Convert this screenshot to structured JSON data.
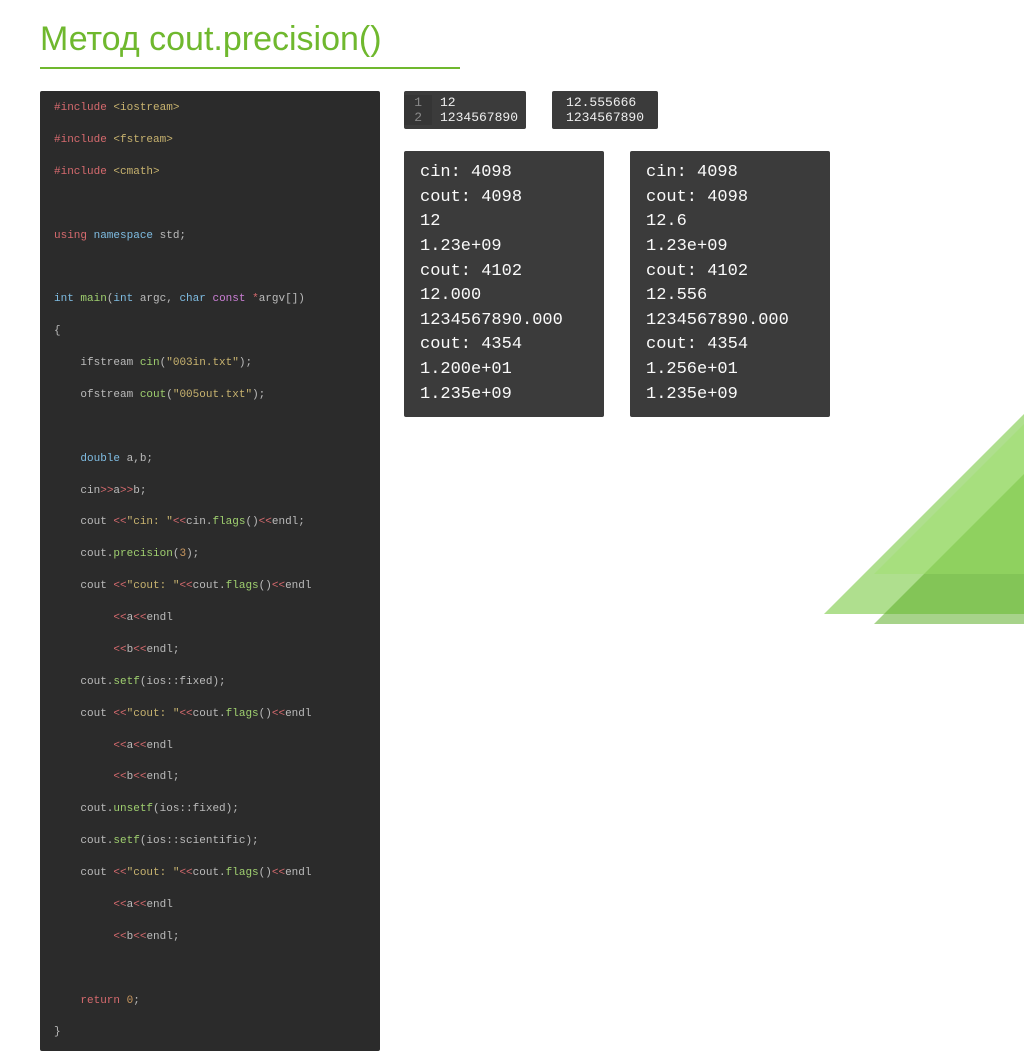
{
  "title": "Метод cout.precision()",
  "code": [
    {
      "cls": "kw-pre",
      "txt": "#include "
    },
    {
      "cls": "str",
      "txt": "<iostream>"
    },
    {
      "br": 1
    },
    {
      "cls": "kw-pre",
      "txt": "#include "
    },
    {
      "cls": "str",
      "txt": "<fstream>"
    },
    {
      "br": 1
    },
    {
      "cls": "kw-pre",
      "txt": "#include "
    },
    {
      "cls": "str",
      "txt": "<cmath>"
    },
    {
      "br": 1
    },
    {
      "br": 1
    },
    {
      "cls": "kw-pre",
      "txt": "using "
    },
    {
      "cls": "kw-type",
      "txt": "namespace"
    },
    {
      "cls": "pale",
      "txt": " std;"
    },
    {
      "br": 1
    },
    {
      "br": 1
    },
    {
      "cls": "kw-type",
      "txt": "int "
    },
    {
      "cls": "fn",
      "txt": "main"
    },
    {
      "cls": "pale",
      "txt": "("
    },
    {
      "cls": "kw-type",
      "txt": "int"
    },
    {
      "cls": "pale",
      "txt": " argc, "
    },
    {
      "cls": "kw-type",
      "txt": "char "
    },
    {
      "cls": "kw-const",
      "txt": "const "
    },
    {
      "cls": "op",
      "txt": "*"
    },
    {
      "cls": "pale",
      "txt": "argv[])"
    },
    {
      "br": 1
    },
    {
      "cls": "pale",
      "txt": "{"
    },
    {
      "br": 1
    },
    {
      "cls": "pale",
      "txt": "    ifstream "
    },
    {
      "cls": "fn",
      "txt": "cin"
    },
    {
      "cls": "pale",
      "txt": "("
    },
    {
      "cls": "str",
      "txt": "\"003in.txt\""
    },
    {
      "cls": "pale",
      "txt": ");"
    },
    {
      "br": 1
    },
    {
      "cls": "pale",
      "txt": "    ofstream "
    },
    {
      "cls": "fn",
      "txt": "cout"
    },
    {
      "cls": "pale",
      "txt": "("
    },
    {
      "cls": "str",
      "txt": "\"005out.txt\""
    },
    {
      "cls": "pale",
      "txt": ");"
    },
    {
      "br": 1
    },
    {
      "br": 1
    },
    {
      "cls": "pale",
      "txt": "    "
    },
    {
      "cls": "kw-type",
      "txt": "double"
    },
    {
      "cls": "pale",
      "txt": " a,b;"
    },
    {
      "br": 1
    },
    {
      "cls": "pale",
      "txt": "    cin"
    },
    {
      "cls": "op",
      "txt": ">>"
    },
    {
      "cls": "pale",
      "txt": "a"
    },
    {
      "cls": "op",
      "txt": ">>"
    },
    {
      "cls": "pale",
      "txt": "b;"
    },
    {
      "br": 1
    },
    {
      "cls": "pale",
      "txt": "    cout "
    },
    {
      "cls": "op",
      "txt": "<<"
    },
    {
      "cls": "str",
      "txt": "\"cin: \""
    },
    {
      "cls": "op",
      "txt": "<<"
    },
    {
      "cls": "pale",
      "txt": "cin."
    },
    {
      "cls": "fn",
      "txt": "flags"
    },
    {
      "cls": "pale",
      "txt": "()"
    },
    {
      "cls": "op",
      "txt": "<<"
    },
    {
      "cls": "pale",
      "txt": "endl;"
    },
    {
      "br": 1
    },
    {
      "cls": "pale",
      "txt": "    cout."
    },
    {
      "cls": "fn",
      "txt": "precision"
    },
    {
      "cls": "pale",
      "txt": "("
    },
    {
      "cls": "num",
      "txt": "3"
    },
    {
      "cls": "pale",
      "txt": ");"
    },
    {
      "br": 1
    },
    {
      "cls": "pale",
      "txt": "    cout "
    },
    {
      "cls": "op",
      "txt": "<<"
    },
    {
      "cls": "str",
      "txt": "\"cout: \""
    },
    {
      "cls": "op",
      "txt": "<<"
    },
    {
      "cls": "pale",
      "txt": "cout."
    },
    {
      "cls": "fn",
      "txt": "flags"
    },
    {
      "cls": "pale",
      "txt": "()"
    },
    {
      "cls": "op",
      "txt": "<<"
    },
    {
      "cls": "pale",
      "txt": "endl"
    },
    {
      "br": 1
    },
    {
      "cls": "pale",
      "txt": "         "
    },
    {
      "cls": "op",
      "txt": "<<"
    },
    {
      "cls": "pale",
      "txt": "a"
    },
    {
      "cls": "op",
      "txt": "<<"
    },
    {
      "cls": "pale",
      "txt": "endl"
    },
    {
      "br": 1
    },
    {
      "cls": "pale",
      "txt": "         "
    },
    {
      "cls": "op",
      "txt": "<<"
    },
    {
      "cls": "pale",
      "txt": "b"
    },
    {
      "cls": "op",
      "txt": "<<"
    },
    {
      "cls": "pale",
      "txt": "endl;"
    },
    {
      "br": 1
    },
    {
      "cls": "pale",
      "txt": "    cout."
    },
    {
      "cls": "fn",
      "txt": "setf"
    },
    {
      "cls": "pale",
      "txt": "(ios::fixed);"
    },
    {
      "br": 1
    },
    {
      "cls": "pale",
      "txt": "    cout "
    },
    {
      "cls": "op",
      "txt": "<<"
    },
    {
      "cls": "str",
      "txt": "\"cout: \""
    },
    {
      "cls": "op",
      "txt": "<<"
    },
    {
      "cls": "pale",
      "txt": "cout."
    },
    {
      "cls": "fn",
      "txt": "flags"
    },
    {
      "cls": "pale",
      "txt": "()"
    },
    {
      "cls": "op",
      "txt": "<<"
    },
    {
      "cls": "pale",
      "txt": "endl"
    },
    {
      "br": 1
    },
    {
      "cls": "pale",
      "txt": "         "
    },
    {
      "cls": "op",
      "txt": "<<"
    },
    {
      "cls": "pale",
      "txt": "a"
    },
    {
      "cls": "op",
      "txt": "<<"
    },
    {
      "cls": "pale",
      "txt": "endl"
    },
    {
      "br": 1
    },
    {
      "cls": "pale",
      "txt": "         "
    },
    {
      "cls": "op",
      "txt": "<<"
    },
    {
      "cls": "pale",
      "txt": "b"
    },
    {
      "cls": "op",
      "txt": "<<"
    },
    {
      "cls": "pale",
      "txt": "endl;"
    },
    {
      "br": 1
    },
    {
      "cls": "pale",
      "txt": "    cout."
    },
    {
      "cls": "fn",
      "txt": "unsetf"
    },
    {
      "cls": "pale",
      "txt": "(ios::fixed);"
    },
    {
      "br": 1
    },
    {
      "cls": "pale",
      "txt": "    cout."
    },
    {
      "cls": "fn",
      "txt": "setf"
    },
    {
      "cls": "pale",
      "txt": "(ios::scientific);"
    },
    {
      "br": 1
    },
    {
      "cls": "pale",
      "txt": "    cout "
    },
    {
      "cls": "op",
      "txt": "<<"
    },
    {
      "cls": "str",
      "txt": "\"cout: \""
    },
    {
      "cls": "op",
      "txt": "<<"
    },
    {
      "cls": "pale",
      "txt": "cout."
    },
    {
      "cls": "fn",
      "txt": "flags"
    },
    {
      "cls": "pale",
      "txt": "()"
    },
    {
      "cls": "op",
      "txt": "<<"
    },
    {
      "cls": "pale",
      "txt": "endl"
    },
    {
      "br": 1
    },
    {
      "cls": "pale",
      "txt": "         "
    },
    {
      "cls": "op",
      "txt": "<<"
    },
    {
      "cls": "pale",
      "txt": "a"
    },
    {
      "cls": "op",
      "txt": "<<"
    },
    {
      "cls": "pale",
      "txt": "endl"
    },
    {
      "br": 1
    },
    {
      "cls": "pale",
      "txt": "         "
    },
    {
      "cls": "op",
      "txt": "<<"
    },
    {
      "cls": "pale",
      "txt": "b"
    },
    {
      "cls": "op",
      "txt": "<<"
    },
    {
      "cls": "pale",
      "txt": "endl;"
    },
    {
      "br": 1
    },
    {
      "br": 1
    },
    {
      "cls": "pale",
      "txt": "    "
    },
    {
      "cls": "kw-pre",
      "txt": "return "
    },
    {
      "cls": "num",
      "txt": "0"
    },
    {
      "cls": "pale",
      "txt": ";"
    },
    {
      "br": 1
    },
    {
      "cls": "pale",
      "txt": "}"
    }
  ],
  "input1": {
    "rows": [
      {
        "n": "1",
        "v": "12"
      },
      {
        "n": "2",
        "v": "1234567890"
      }
    ]
  },
  "input2": {
    "rows": [
      "12.555666",
      "1234567890"
    ]
  },
  "output1": [
    "cin: 4098",
    "cout: 4098",
    "12",
    "1.23e+09",
    "cout: 4102",
    "12.000",
    "1234567890.000",
    "cout: 4354",
    "1.200e+01",
    "1.235e+09"
  ],
  "output2": [
    "cin: 4098",
    "cout: 4098",
    "12.6",
    "1.23e+09",
    "cout: 4102",
    "12.556",
    "1234567890.000",
    "cout: 4354",
    "1.256e+01",
    "1.235e+09"
  ]
}
